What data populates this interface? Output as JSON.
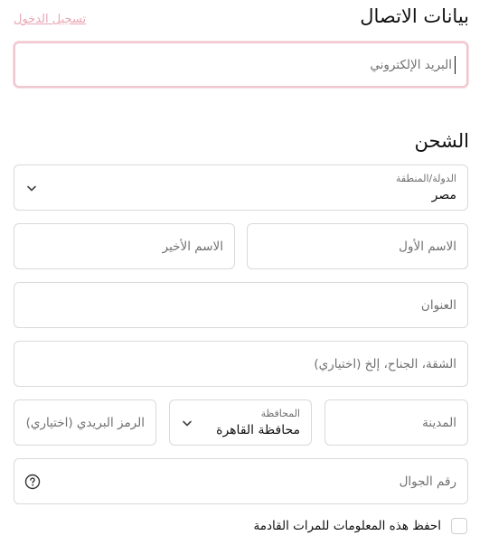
{
  "contact": {
    "heading": "بيانات الاتصال",
    "login_link": "تسجيل الدخول",
    "email_placeholder": "البريد الإلكتروني"
  },
  "shipping": {
    "heading": "الشحن",
    "country": {
      "label": "الدولة/المنطقة",
      "value": "مصر"
    },
    "first_name_placeholder": "الاسم الأول",
    "last_name_placeholder": "الاسم الأخير",
    "address_placeholder": "العنوان",
    "apartment_placeholder": "الشقة، الجناح، إلخ (اختياري)",
    "city_placeholder": "المدينة",
    "governorate": {
      "label": "المحافظة",
      "value": "محافظة القاهرة"
    },
    "postal_placeholder": "الرمز البريدي (اختياري)",
    "phone_placeholder": "رقم الجوال",
    "save_info_label": "احفظ هذه المعلومات للمرات القادمة"
  },
  "colors": {
    "accent_link": "#e8a7b3",
    "focus_border": "#f1c6cf",
    "border": "#d9d9d9"
  },
  "icons": {
    "select": "chevron-down-icon",
    "help": "help-circle-icon"
  }
}
